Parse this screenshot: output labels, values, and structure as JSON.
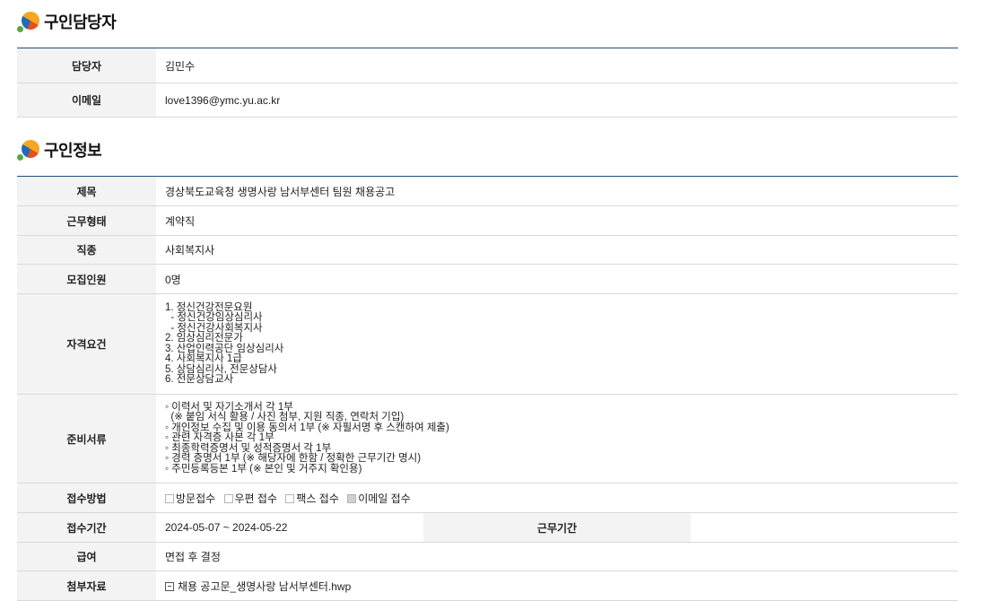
{
  "contact_section": {
    "title": "구인담당자",
    "rows": [
      {
        "label": "담당자",
        "value": "김민수"
      },
      {
        "label": "이메일",
        "value": "love1396@ymc.yu.ac.kr"
      }
    ]
  },
  "job_section": {
    "title": "구인정보",
    "title_row": {
      "label": "제목",
      "value": "경상북도교육청 생명사랑 남서부센터 팀원 채용공고"
    },
    "employment_type": {
      "label": "근무형태",
      "value": "계약직"
    },
    "job_category": {
      "label": "직종",
      "value": "사회복지사"
    },
    "headcount": {
      "label": "모집인원",
      "value": "0명"
    },
    "qualifications": {
      "label": "자격요건",
      "lines": [
        "1. 정신건강전문요원",
        "  - 정신건강임상심리사",
        "  - 정신건강사회복지사",
        "2. 임상심리전문가",
        "3. 산업인력공단 임상심리사",
        "4. 사회복지사 1급",
        "5. 상담심리사, 전문상담사",
        "6. 전문상담교사"
      ]
    },
    "documents": {
      "label": "준비서류",
      "lines": [
        "◦ 이력서 및 자기소개서 각 1부",
        "  (※ 붙임 서식 활용 / 사진 첨부, 지원 직종, 연락처 기입)",
        "◦ 개인정보 수집 및 이용 동의서 1부 (※ 자필서명 후 스캔하여 제출)",
        "◦ 관련 자격증 사본 각 1부",
        "◦ 최종학력증명서 및 성적증명서 각 1부",
        "◦ 경력 증명서 1부 (※ 해당자에 한함 / 정확한 근무기간 명시)",
        "◦ 주민등록등본 1부 (※ 본인 및 거주지 확인용)"
      ]
    },
    "application_method": {
      "label": "접수방법",
      "options": [
        {
          "label": "방문접수",
          "checked": false
        },
        {
          "label": "우편 접수",
          "checked": false
        },
        {
          "label": "팩스 접수",
          "checked": false
        },
        {
          "label": "이메일 접수",
          "checked": true
        }
      ]
    },
    "application_period": {
      "label": "접수기간",
      "value": "2024-05-07 ~ 2024-05-22"
    },
    "work_period": {
      "label": "근무기간",
      "value": ""
    },
    "salary": {
      "label": "급여",
      "value": "면접 후 결정"
    },
    "attachment": {
      "label": "첨부자료",
      "value": "채용 공고문_생명사랑 남서부센터.hwp"
    }
  }
}
